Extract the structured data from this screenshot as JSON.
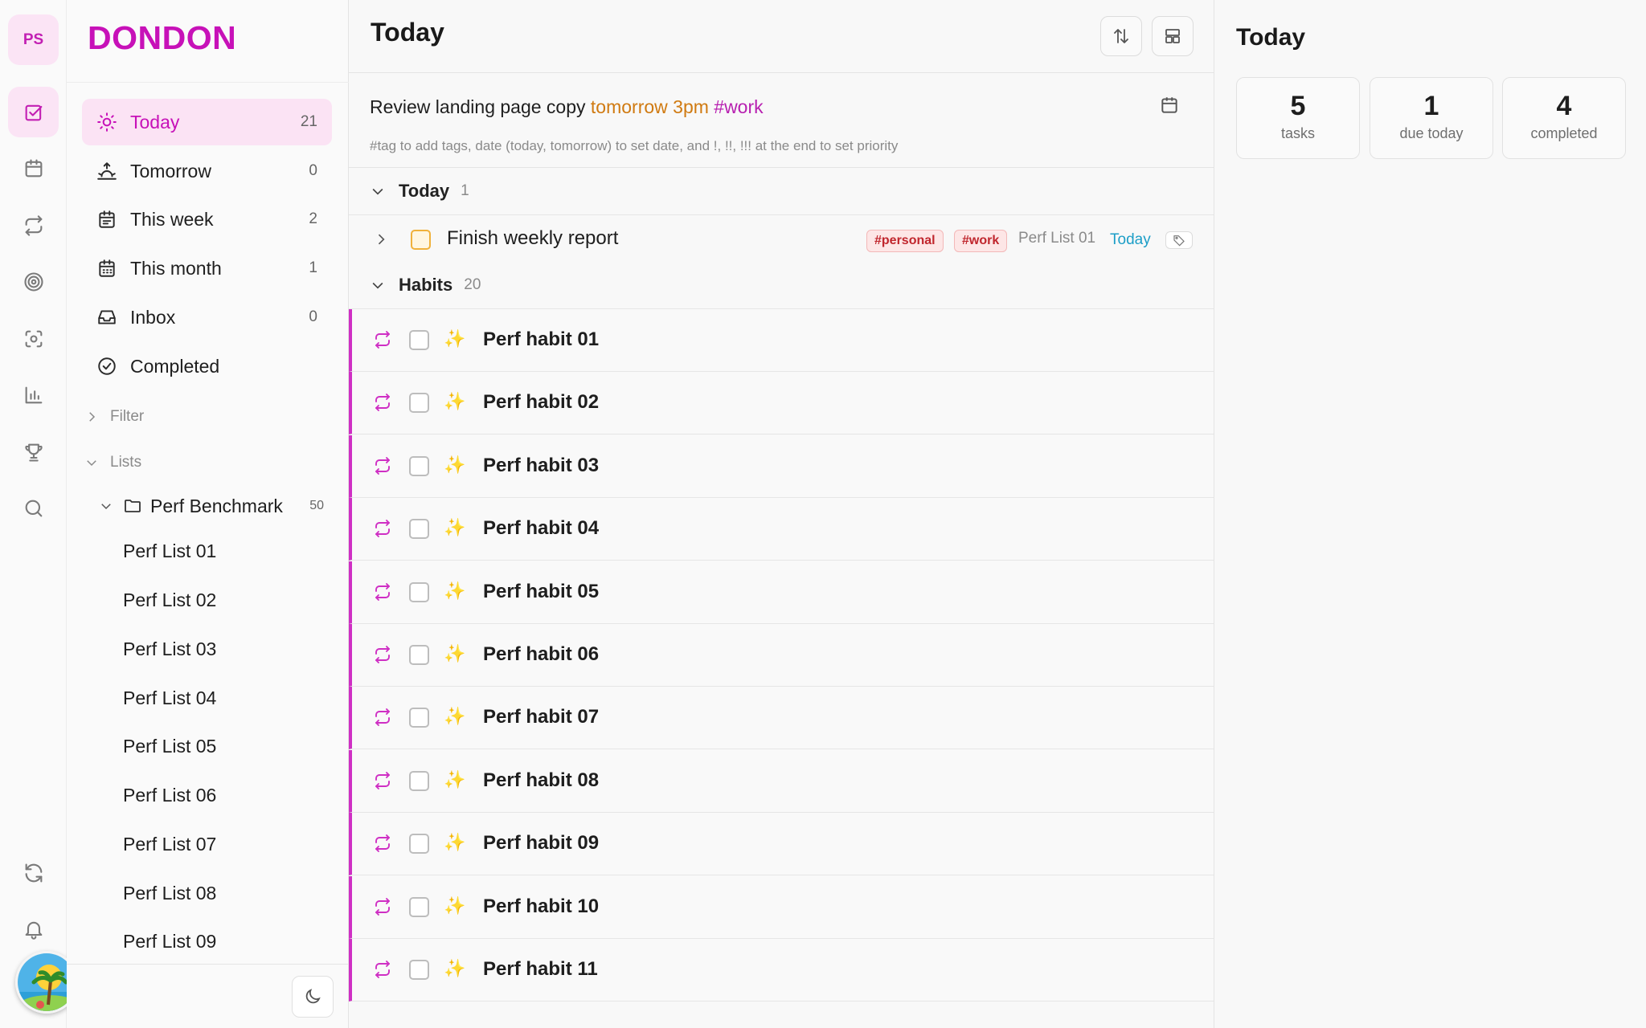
{
  "rail": {
    "initials": "PS",
    "items": [
      "tasks-icon",
      "calendar-icon",
      "repeat-icon",
      "target-icon",
      "focus-icon",
      "chart-icon",
      "trophy-icon",
      "search-icon",
      "sync-icon",
      "bell-icon"
    ]
  },
  "sidebar": {
    "brand": "DONDON",
    "nav": [
      {
        "label": "Today",
        "count": "21",
        "icon": "sun-icon"
      },
      {
        "label": "Tomorrow",
        "count": "0",
        "icon": "sunrise-icon"
      },
      {
        "label": "This week",
        "count": "2",
        "icon": "calendar-week-icon"
      },
      {
        "label": "This month",
        "count": "1",
        "icon": "calendar-month-icon"
      },
      {
        "label": "Inbox",
        "count": "0",
        "icon": "inbox-icon"
      },
      {
        "label": "Completed",
        "count": "",
        "icon": "check-circle-icon"
      }
    ],
    "filter_label": "Filter",
    "lists_label": "Lists",
    "folder": {
      "label": "Perf Benchmark",
      "count": "50"
    },
    "lists": [
      "Perf List 01",
      "Perf List 02",
      "Perf List 03",
      "Perf List 04",
      "Perf List 05",
      "Perf List 06",
      "Perf List 07",
      "Perf List 08",
      "Perf List 09"
    ]
  },
  "main": {
    "title": "Today",
    "quick_add": {
      "text": "Review landing page copy ",
      "date": "tomorrow 3pm",
      "tag": "#work",
      "hint": "#tag to add tags, date (today, tomorrow) to set date, and !, !!, !!! at the end to set priority"
    },
    "today_group": {
      "label": "Today",
      "count": "1"
    },
    "task": {
      "title": "Finish weekly report",
      "tags": [
        "#personal",
        "#work"
      ],
      "list": "Perf List 01",
      "date": "Today"
    },
    "habits_group": {
      "label": "Habits",
      "count": "20"
    },
    "habits": [
      "Perf habit 01",
      "Perf habit 02",
      "Perf habit 03",
      "Perf habit 04",
      "Perf habit 05",
      "Perf habit 06",
      "Perf habit 07",
      "Perf habit 08",
      "Perf habit 09",
      "Perf habit 10",
      "Perf habit 11"
    ]
  },
  "right": {
    "title": "Today",
    "stats": [
      {
        "num": "5",
        "label": "tasks"
      },
      {
        "num": "1",
        "label": "due today"
      },
      {
        "num": "4",
        "label": "completed"
      }
    ]
  },
  "colors": {
    "accent": "#c711b8",
    "habit_bar": "#cf2fc4",
    "date": "#d07a11",
    "today_date": "#1c9ec7"
  }
}
